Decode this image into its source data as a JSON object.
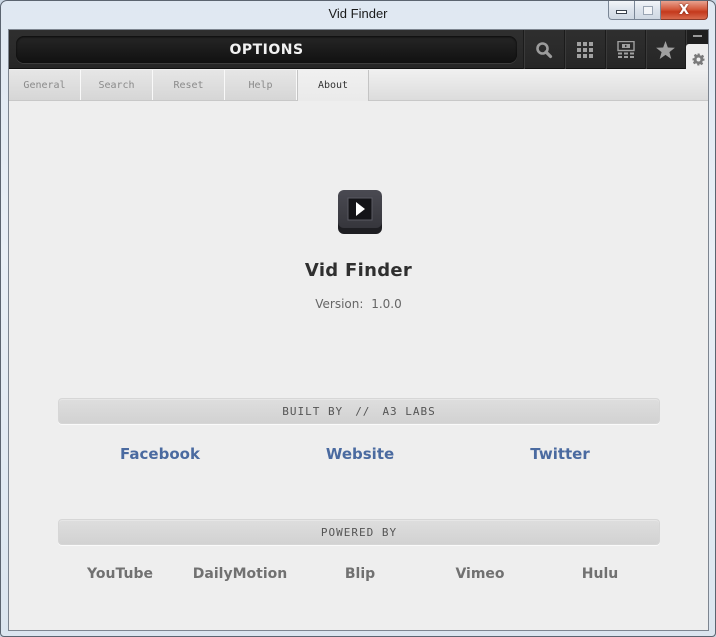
{
  "window": {
    "title": "Vid Finder",
    "controls": {
      "minimize": "minimize",
      "maximize": "maximize",
      "close": "X"
    }
  },
  "toolbar": {
    "title": "OPTIONS",
    "buttons": [
      {
        "name": "search",
        "icon": "search-icon"
      },
      {
        "name": "grid",
        "icon": "grid-icon"
      },
      {
        "name": "player",
        "icon": "screen-icon"
      },
      {
        "name": "favorites",
        "icon": "star-icon"
      }
    ],
    "side": {
      "minimize_icon": "minus-icon",
      "settings_icon": "gear-icon"
    }
  },
  "tabs": [
    {
      "label": "General",
      "active": false
    },
    {
      "label": "Search",
      "active": false
    },
    {
      "label": "Reset",
      "active": false
    },
    {
      "label": "Help",
      "active": false
    },
    {
      "label": "About",
      "active": true
    }
  ],
  "about": {
    "app_icon": "play-icon",
    "app_name": "Vid Finder",
    "version_label": "Version:",
    "version": "1.0.0",
    "built_by": {
      "label": "BUILT BY",
      "separator": "//",
      "company": "A3 LABS"
    },
    "links": [
      {
        "label": "Facebook"
      },
      {
        "label": "Website"
      },
      {
        "label": "Twitter"
      }
    ],
    "powered_by": {
      "label": "POWERED BY",
      "providers": [
        "YouTube",
        "DailyMotion",
        "Blip",
        "Vimeo",
        "Hulu"
      ]
    }
  },
  "colors": {
    "link": "#4a6aa0",
    "provider": "#717171",
    "toolbar_bg": "#262626",
    "close_button": "#c4391c"
  }
}
